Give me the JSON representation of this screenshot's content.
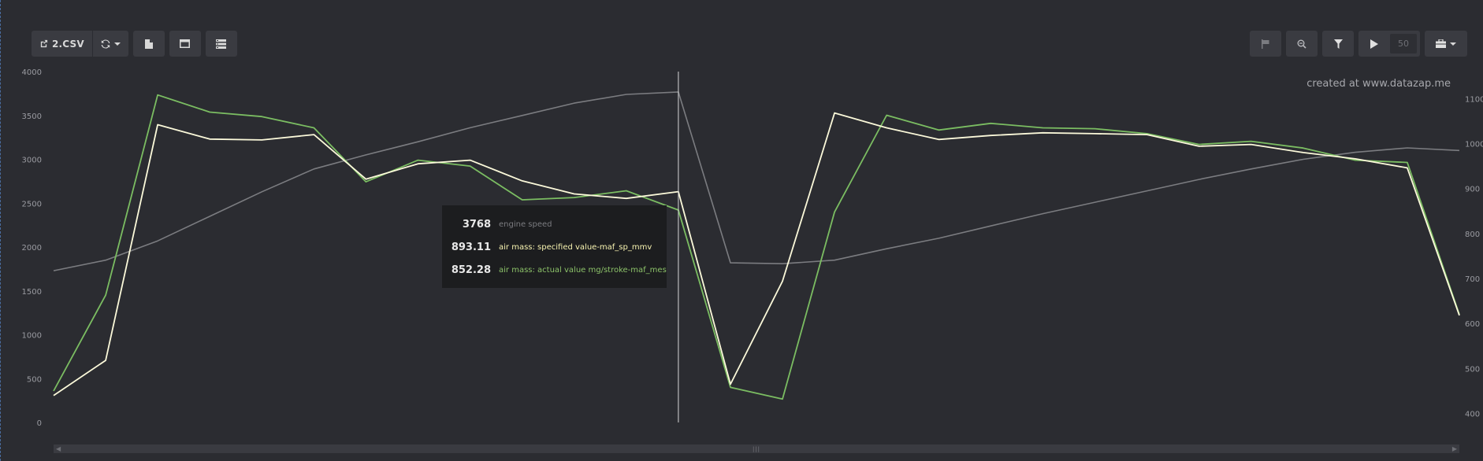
{
  "toolbar": {
    "file_label": "2.CSV",
    "count_value": "50"
  },
  "icons": {
    "share": "external-link-icon",
    "sync": "refresh-icon",
    "file": "file-icon",
    "layout_single": "panel-icon",
    "layout_multi": "list-icon",
    "flag": "flag-icon",
    "zoom": "zoom-out-icon",
    "filter": "funnel-icon",
    "play": "play-icon",
    "tools": "toolbox-icon"
  },
  "watermark": "created at www.datazap.me",
  "tooltip": {
    "rows": [
      {
        "value": "3768",
        "name": "engine speed",
        "color": "#7b7c80"
      },
      {
        "value": "893.11",
        "name": "air mass: specified value-maf_sp_mmv",
        "color": "#f7f3b0"
      },
      {
        "value": "852.28",
        "name": "air mass: actual value mg/stroke-maf_mes",
        "color": "#8cc269"
      }
    ]
  },
  "colors": {
    "background": "#2b2c31",
    "engine_speed": "#7b7c80",
    "specified": "#fbf9da",
    "actual": "#7bbd62",
    "cursor": "#d8d8d8"
  },
  "chart_data": {
    "type": "line",
    "x": [
      0,
      1,
      2,
      3,
      4,
      5,
      6,
      7,
      8,
      9,
      10,
      11,
      12,
      13,
      14,
      15,
      16,
      17,
      18,
      19,
      20,
      21,
      22,
      23,
      24,
      25,
      26,
      27
    ],
    "y_left_ticks": [
      "0",
      "500",
      "1000",
      "1500",
      "2000",
      "2500",
      "3000",
      "3500",
      "4000"
    ],
    "y_right_ticks": [
      "400",
      "500",
      "600",
      "700",
      "800",
      "900",
      "1000",
      "1100"
    ],
    "ylim_left": [
      0,
      4000
    ],
    "ylim_right": [
      380,
      1160
    ],
    "cursor_index": 12,
    "legend": "none",
    "grid": false,
    "series": [
      {
        "name": "engine speed",
        "axis": "left",
        "values": [
          1730,
          1850,
          2070,
          2350,
          2630,
          2890,
          3050,
          3200,
          3360,
          3500,
          3640,
          3740,
          3768,
          1820,
          1810,
          1850,
          1980,
          2100,
          2240,
          2380,
          2510,
          2640,
          2770,
          2890,
          3000,
          3080,
          3130,
          3100
        ]
      },
      {
        "name": "air mass: specified value-maf_sp_mmv",
        "axis": "right",
        "values": [
          440,
          518,
          1042,
          1010,
          1008,
          1020,
          921,
          955,
          963,
          917,
          888,
          878,
          893.11,
          465,
          694,
          1068,
          1035,
          1009,
          1018,
          1024,
          1022,
          1020,
          994,
          998,
          980,
          966,
          946,
          618
        ]
      },
      {
        "name": "air mass: actual value mg/stroke-maf_mes",
        "axis": "right",
        "values": [
          450,
          663,
          1108,
          1070,
          1060,
          1035,
          915,
          963,
          950,
          875,
          880,
          895,
          852.28,
          458,
          432,
          848,
          1063,
          1030,
          1045,
          1035,
          1033,
          1022,
          998,
          1005,
          990,
          963,
          958,
          620
        ]
      }
    ]
  }
}
